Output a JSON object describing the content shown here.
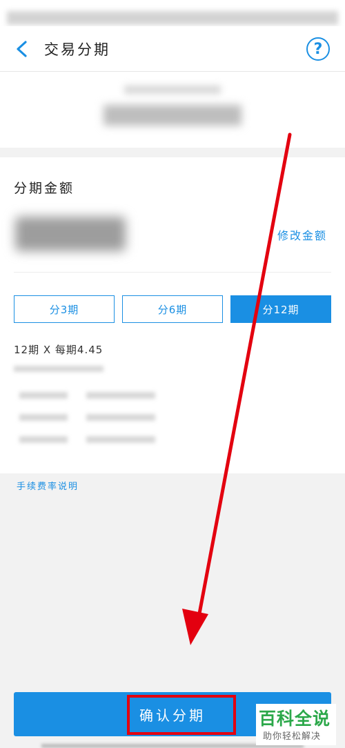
{
  "header": {
    "title": "交易分期",
    "back_icon": "chevron-left-icon",
    "help_label": "?"
  },
  "installment": {
    "section_title": "分期金额",
    "modify_amount": "修改金额",
    "terms": [
      {
        "label": "分3期",
        "selected": false
      },
      {
        "label": "分6期",
        "selected": false
      },
      {
        "label": "分12期",
        "selected": true
      }
    ],
    "detail": "12期 X 每期4.45",
    "fee_link": "手续费率说明"
  },
  "footer": {
    "confirm_label": "确认分期"
  },
  "watermark": {
    "title": "百科全说",
    "subtitle": "助你轻松解决"
  },
  "colors": {
    "accent": "#1a8fe3",
    "annotation_red": "#e3000f",
    "watermark_green": "#2ca84a"
  }
}
